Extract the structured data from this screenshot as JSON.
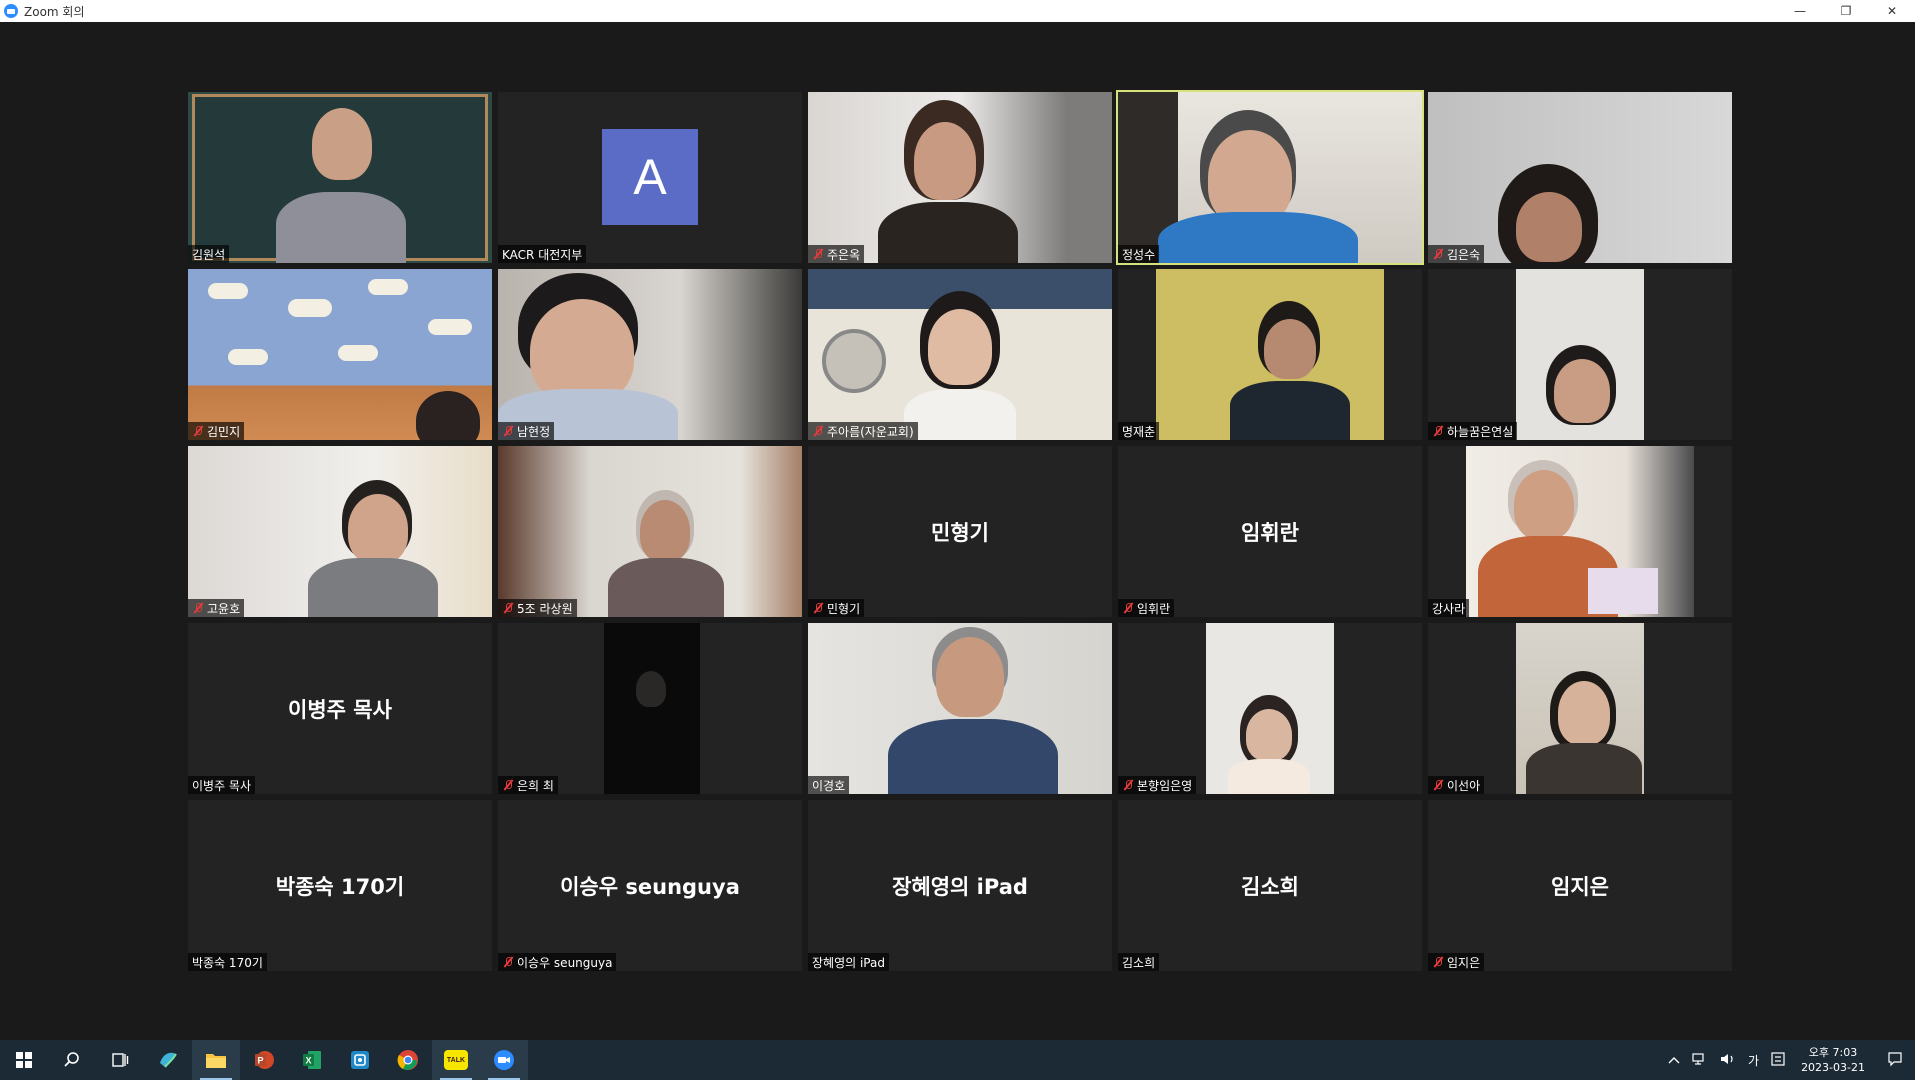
{
  "window": {
    "title": "Zoom 회의",
    "minimize": "—",
    "restore": "❐",
    "close": "✕"
  },
  "tiles": [
    {
      "label": "김원석",
      "muted": false,
      "type": "video",
      "active": false
    },
    {
      "label": "KACR 대전지부",
      "muted": false,
      "type": "avatar",
      "avatar_letter": "A"
    },
    {
      "label": "주은옥",
      "muted": true,
      "type": "video"
    },
    {
      "label": "정성수",
      "muted": false,
      "type": "video",
      "active": true
    },
    {
      "label": "김은숙",
      "muted": true,
      "type": "video"
    },
    {
      "label": "김민지",
      "muted": true,
      "type": "video"
    },
    {
      "label": "남현정",
      "muted": true,
      "type": "video"
    },
    {
      "label": "주아름(자운교회)",
      "muted": true,
      "type": "video"
    },
    {
      "label": "명재춘",
      "muted": false,
      "type": "video"
    },
    {
      "label": "하늘꿈은연실",
      "muted": true,
      "type": "video"
    },
    {
      "label": "고윤호",
      "muted": true,
      "type": "video"
    },
    {
      "label": "5조 라상원",
      "muted": true,
      "type": "video"
    },
    {
      "label": "민형기",
      "muted": true,
      "type": "name",
      "center_name": "민형기"
    },
    {
      "label": "임휘란",
      "muted": true,
      "type": "name",
      "center_name": "임휘란"
    },
    {
      "label": "강사라",
      "muted": false,
      "type": "video"
    },
    {
      "label": "이병주 목사",
      "muted": false,
      "type": "name",
      "center_name": "이병주 목사"
    },
    {
      "label": "은희 최",
      "muted": true,
      "type": "video"
    },
    {
      "label": "이경호",
      "muted": false,
      "type": "video"
    },
    {
      "label": "본향임은영",
      "muted": true,
      "type": "video"
    },
    {
      "label": "이선아",
      "muted": true,
      "type": "video"
    },
    {
      "label": "박종숙 170기",
      "muted": false,
      "type": "name",
      "center_name": "박종숙 170기"
    },
    {
      "label": "이승우 seunguya",
      "muted": true,
      "type": "name",
      "center_name": "이승우 seunguya"
    },
    {
      "label": "장혜영의 iPad",
      "muted": false,
      "type": "name",
      "center_name": "장혜영의 iPad"
    },
    {
      "label": "김소희",
      "muted": false,
      "type": "name",
      "center_name": "김소희"
    },
    {
      "label": "임지은",
      "muted": true,
      "type": "name",
      "center_name": "임지은"
    }
  ],
  "taskbar": {
    "apps": [
      "start-icon",
      "search-icon",
      "task-view-icon",
      "app-bird-icon",
      "file-explorer-icon",
      "powerpoint-icon",
      "excel-icon",
      "app-blue-icon",
      "chrome-icon",
      "kakaotalk-icon",
      "zoom-icon"
    ],
    "kakao_label": "TALK",
    "ime": "가",
    "time": "오후 7:03",
    "date": "2023-03-21"
  }
}
